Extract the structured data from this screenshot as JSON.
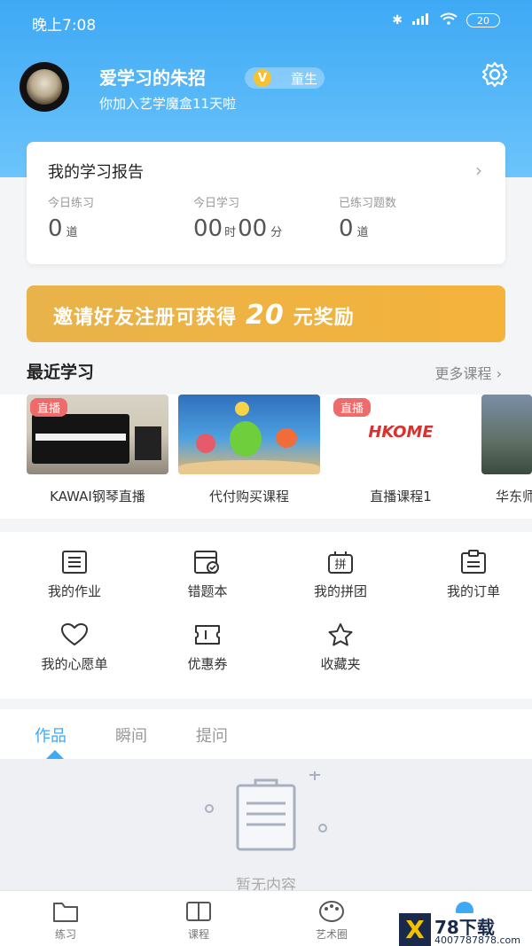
{
  "status_bar": {
    "time": "晚上7:08",
    "battery": "20"
  },
  "profile": {
    "username": "爱学习的朱招",
    "badge_letter": "V",
    "badge_text": "童生",
    "joined_text": "你加入艺学魔盒11天啦"
  },
  "report": {
    "title": "我的学习报告",
    "stats": [
      {
        "label": "今日练习",
        "value": "0",
        "unit": "道"
      },
      {
        "label": "今日学习",
        "value_h": "00",
        "unit_h": "时",
        "value_m": "00",
        "unit_m": "分"
      },
      {
        "label": "已练习题数",
        "value": "0",
        "unit": "道"
      }
    ]
  },
  "banner": {
    "text_before": "邀请好友注册可获得",
    "amount": "20",
    "text_after": "元奖励"
  },
  "recent": {
    "title": "最近学习",
    "more": "更多课程",
    "live_tag": "直播",
    "courses": [
      {
        "name": "KAWAI钢琴直播"
      },
      {
        "name": "代付购买课程"
      },
      {
        "name": "直播课程1",
        "thumb_text": "HKOME"
      },
      {
        "name": "华东师"
      }
    ]
  },
  "menu": [
    {
      "label": "我的作业",
      "icon": "homework-icon"
    },
    {
      "label": "错题本",
      "icon": "wrongbook-icon"
    },
    {
      "label": "我的拼团",
      "icon": "group-icon",
      "glyph": "拼"
    },
    {
      "label": "我的订单",
      "icon": "order-icon"
    },
    {
      "label": "我的心愿单",
      "icon": "heart-icon"
    },
    {
      "label": "优惠券",
      "icon": "coupon-icon"
    },
    {
      "label": "收藏夹",
      "icon": "star-icon"
    }
  ],
  "tabs": [
    "作品",
    "瞬间",
    "提问"
  ],
  "empty_text": "暂无内容",
  "nav": [
    {
      "label": "练习",
      "icon": "folder-icon"
    },
    {
      "label": "课程",
      "icon": "book-icon"
    },
    {
      "label": "艺术圈",
      "icon": "palette-icon"
    }
  ],
  "watermark": {
    "logo": "X",
    "title": "78下载",
    "url": "4007787878.com"
  },
  "colors": {
    "primary": "#3ea9f5",
    "banner": "#f0b341",
    "live": "#ef6a6a"
  }
}
